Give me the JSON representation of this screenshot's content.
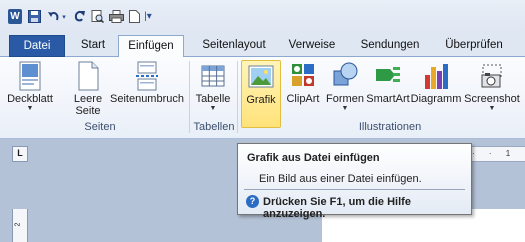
{
  "qat": {
    "word_logo": "W",
    "icons": [
      "save-icon",
      "undo-icon",
      "redo-icon",
      "print-preview-icon",
      "print-icon",
      "new-document-icon",
      "customize-qat-icon"
    ]
  },
  "tabs": [
    "Datei",
    "Start",
    "Einfügen",
    "Seitenlayout",
    "Verweise",
    "Sendungen",
    "Überprüfen"
  ],
  "active_tab": "Einfügen",
  "ribbon": {
    "seiten": {
      "group": "Seiten",
      "deckblatt": "Deckblatt",
      "leere_1": "Leere",
      "leere_2": "Seite",
      "umbruch": "Seitenumbruch"
    },
    "tabellen": {
      "group": "Tabellen",
      "tabelle": "Tabelle"
    },
    "illustrationen": {
      "group": "Illustrationen",
      "grafik": "Grafik",
      "clipart": "ClipArt",
      "formen": "Formen",
      "smartart": "SmartArt",
      "diagramm": "Diagramm",
      "screenshot": "Screenshot"
    }
  },
  "ruler": {
    "corner": "L",
    "marks": "· · 1",
    "vmark": "2"
  },
  "tooltip": {
    "title": "Grafik aus Datei einfügen",
    "description": "Ein Bild aus einer Datei einfügen.",
    "help": "Drücken Sie F1, um die Hilfe anzuzeigen.",
    "help_symbol": "?"
  },
  "colors": {
    "datei_tab": "#2a5aa6",
    "highlight": "#ffe27a",
    "document_bg": "#b4c2d7"
  }
}
